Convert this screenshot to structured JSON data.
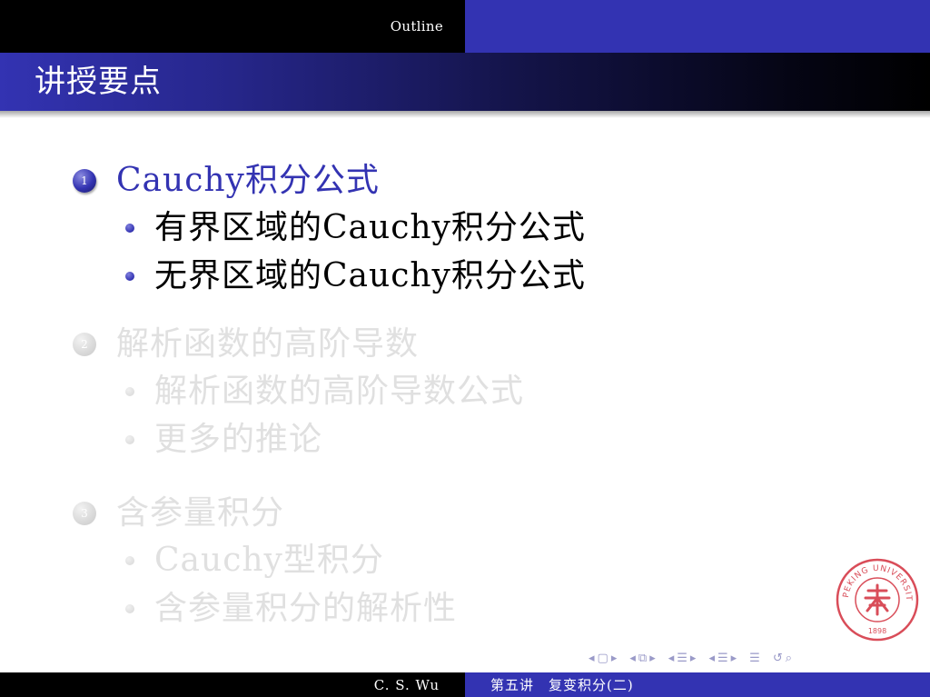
{
  "headline": {
    "text": "Outline"
  },
  "frame": {
    "title": "讲授要点"
  },
  "outline": {
    "sections": [
      {
        "number": "1",
        "title": "Cauchy积分公式",
        "state": "active",
        "items": [
          "有界区域的Cauchy积分公式",
          "无界区域的Cauchy积分公式"
        ]
      },
      {
        "number": "2",
        "title": "解析函数的高阶导数",
        "state": "dim",
        "items": [
          "解析函数的高阶导数公式",
          "更多的推论"
        ]
      },
      {
        "number": "3",
        "title": "含参量积分",
        "state": "dim",
        "items": [
          "Cauchy型积分",
          "含参量积分的解析性"
        ]
      }
    ]
  },
  "seal": {
    "text_top": "PEKING UNIVERSITY",
    "year": "1898",
    "icon": "peking-university-seal"
  },
  "nav": {
    "icons": [
      "frame-nav-icon",
      "subsection-nav-icon",
      "section-nav-icon",
      "subsubsection-nav-icon",
      "toc-icon",
      "search-icon"
    ]
  },
  "footer": {
    "author": "C. S. Wu",
    "lecture": "第五讲　复变积分(二)"
  },
  "colors": {
    "structure": "#3333b2",
    "inactive_text": "#e0e0e0",
    "seal_red": "#d94d59"
  }
}
